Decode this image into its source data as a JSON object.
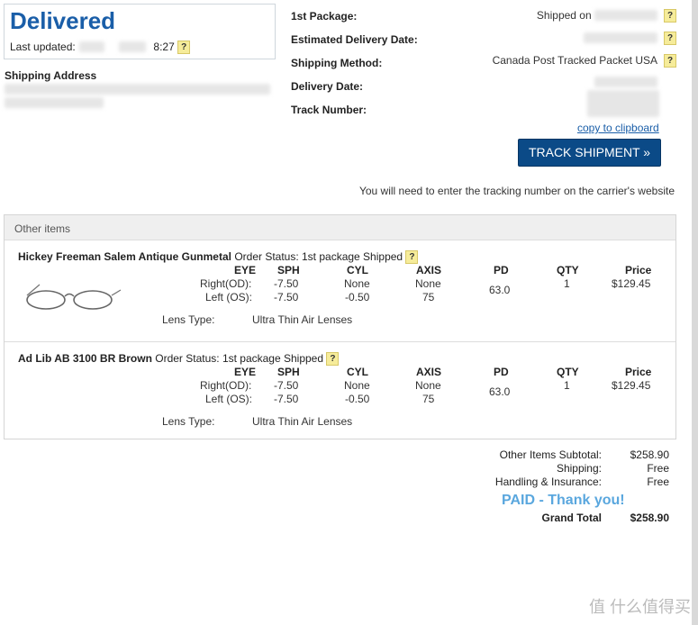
{
  "status": {
    "title": "Delivered",
    "last_updated_label": "Last updated:",
    "last_updated_time": "8:27"
  },
  "shipping": {
    "label": "Shipping Address"
  },
  "package": {
    "package_label": "1st Package:",
    "package_value_prefix": "Shipped on",
    "est_delivery_label": "Estimated Delivery Date:",
    "method_label": "Shipping Method:",
    "method_value": "Canada Post Tracked Packet USA",
    "delivery_date_label": "Delivery Date:",
    "track_number_label": "Track Number:",
    "copy_link": "copy to clipboard",
    "track_button": "TRACK SHIPMENT  »",
    "note": "You will need to enter the tracking number on the carrier's website"
  },
  "items": {
    "header": "Other items",
    "columns": {
      "eye": "EYE",
      "sph": "SPH",
      "cyl": "CYL",
      "axis": "AXIS",
      "pd": "PD",
      "qty": "QTY",
      "price": "Price"
    },
    "list": [
      {
        "name": "Hickey Freeman Salem Antique Gunmetal",
        "status": "Order Status: 1st package Shipped",
        "right_label": "Right(OD):",
        "left_label": "Left (OS):",
        "r_sph": "-7.50",
        "r_cyl": "None",
        "r_axis": "None",
        "l_sph": "-7.50",
        "l_cyl": "-0.50",
        "l_axis": "75",
        "pd": "63.0",
        "qty": "1",
        "price": "$129.45",
        "lens_label": "Lens Type:",
        "lens_value": "Ultra Thin Air Lenses"
      },
      {
        "name": "Ad Lib AB 3100 BR Brown",
        "status": "Order Status: 1st package Shipped",
        "right_label": "Right(OD):",
        "left_label": "Left (OS):",
        "r_sph": "-7.50",
        "r_cyl": "None",
        "r_axis": "None",
        "l_sph": "-7.50",
        "l_cyl": "-0.50",
        "l_axis": "75",
        "pd": "63.0",
        "qty": "1",
        "price": "$129.45",
        "lens_label": "Lens Type:",
        "lens_value": "Ultra Thin Air Lenses"
      }
    ]
  },
  "summary": {
    "subtotal_label": "Other Items Subtotal:",
    "subtotal_value": "$258.90",
    "shipping_label": "Shipping:",
    "shipping_value": "Free",
    "handling_label": "Handling & Insurance:",
    "handling_value": "Free",
    "paid": "PAID - Thank you!",
    "grand_label": "Grand Total",
    "grand_value": "$258.90"
  },
  "watermark": "值 什么值得买"
}
